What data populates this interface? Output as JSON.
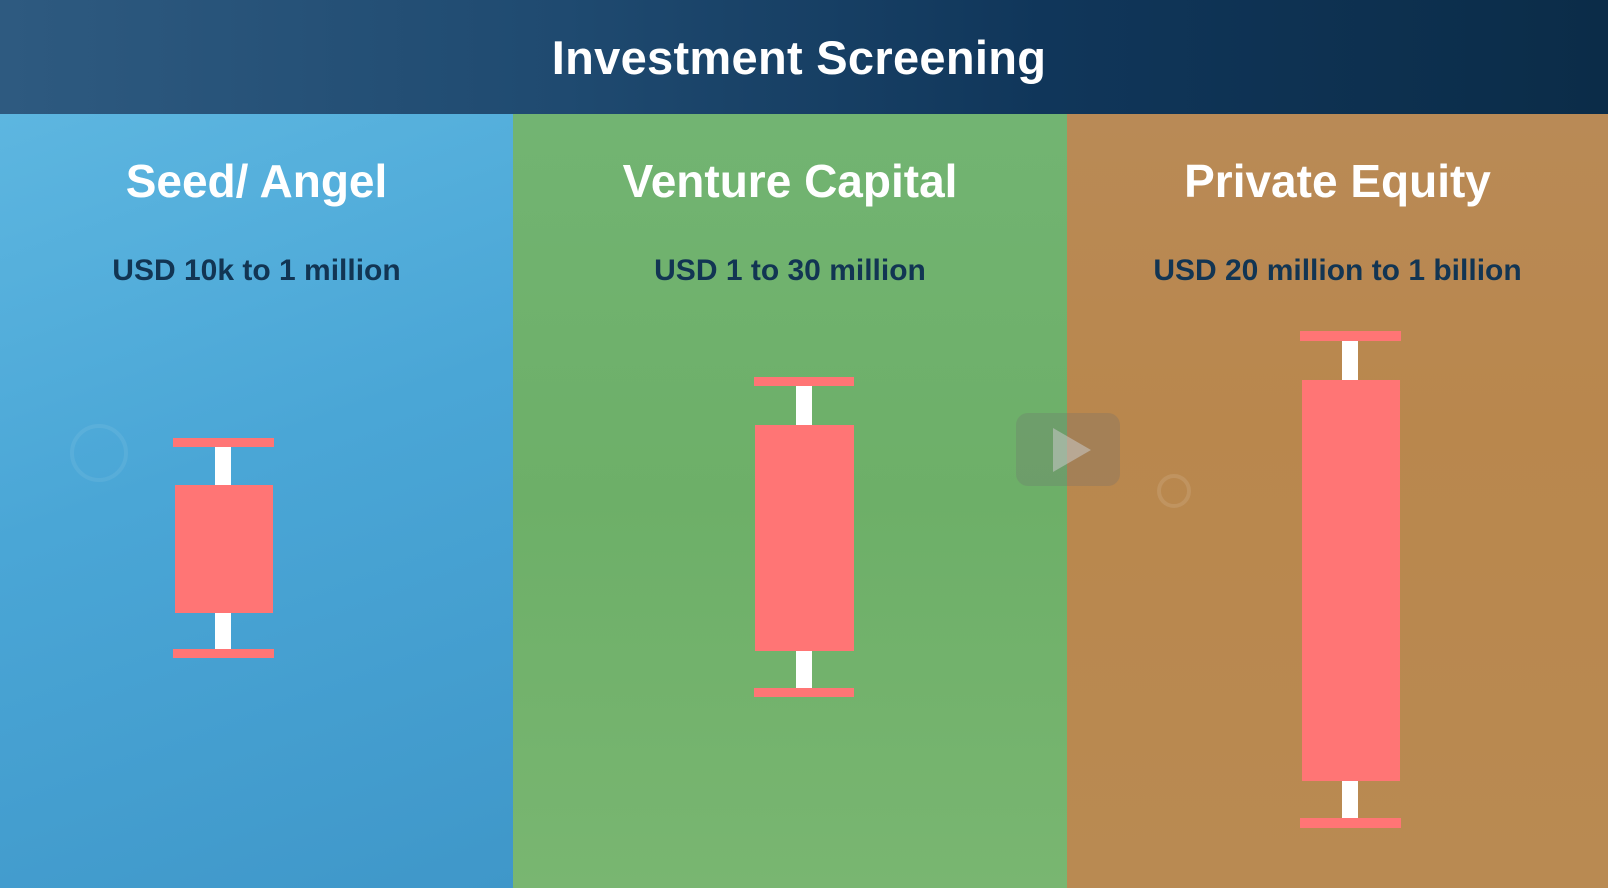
{
  "header": {
    "title": "Investment Screening"
  },
  "panels": [
    {
      "title": "Seed/ Angel",
      "range": "USD 10k to 1 million",
      "color": "#4aa6d6"
    },
    {
      "title": "Venture Capital",
      "range": "USD 1 to 30 million",
      "color": "#6daf68"
    },
    {
      "title": "Private Equity",
      "range": "USD 20 million to 1 billion",
      "color": "#b9874d"
    }
  ],
  "candle_style": {
    "body_color": "#ff7575",
    "wick_color": "#ffffff"
  },
  "player": {
    "icon": "play-icon"
  }
}
